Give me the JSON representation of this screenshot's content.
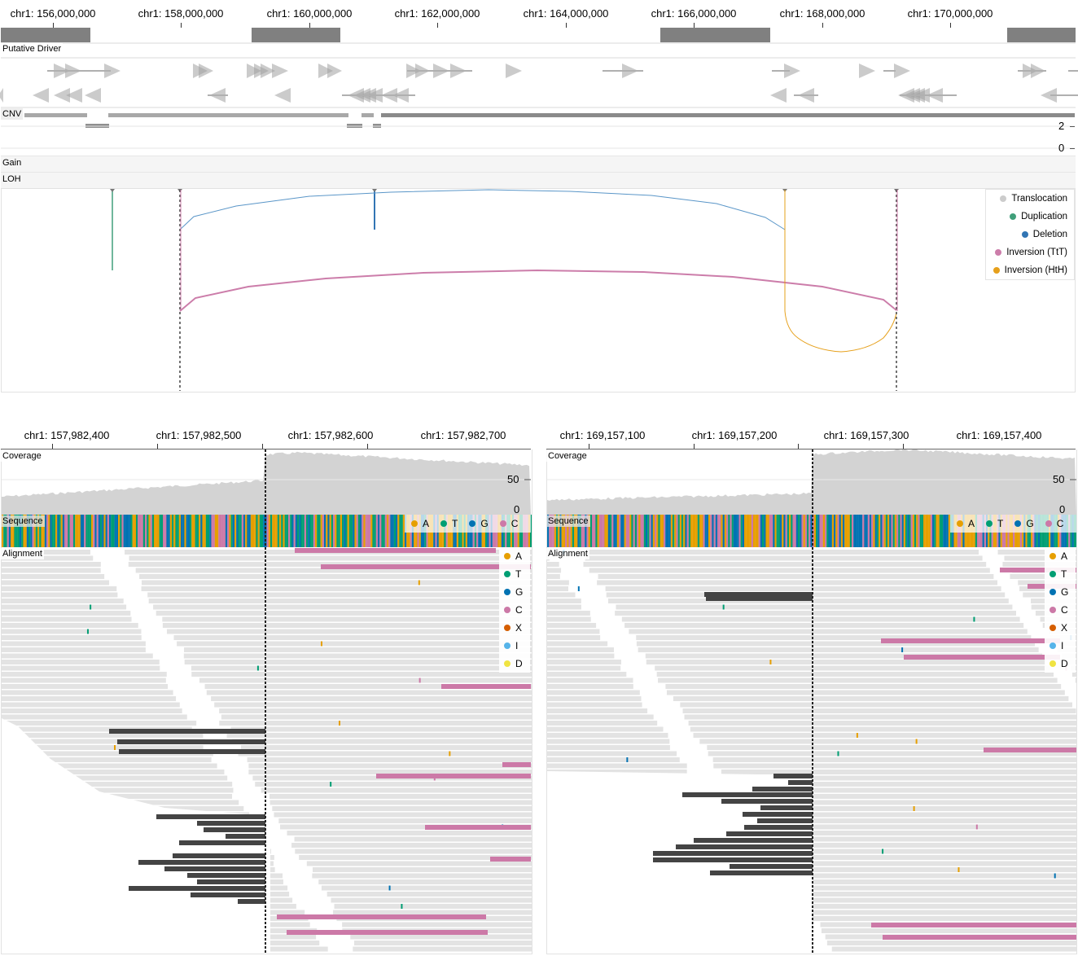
{
  "overview": {
    "axis_ticks": [
      "chr1: 156,000,000",
      "chr1: 158,000,000",
      "chr1: 160,000,000",
      "chr1: 162,000,000",
      "chr1: 164,000,000",
      "chr1: 166,000,000",
      "chr1: 168,000,000",
      "chr1: 170,000,000"
    ],
    "ideogram_dark_bands": [
      [
        0.0,
        0.083
      ],
      [
        0.233,
        0.316
      ],
      [
        0.614,
        0.716
      ],
      [
        0.936,
        1.0
      ]
    ],
    "tracks": {
      "putative_driver": "Putative Driver",
      "cnv": "CNV",
      "gain": "Gain",
      "loh": "LOH"
    },
    "cnv_axis": [
      "2",
      "0"
    ],
    "sv_legend": [
      {
        "label": "Translocation",
        "color": "#cccccc"
      },
      {
        "label": "Duplication",
        "color": "#409F7A"
      },
      {
        "label": "Deletion",
        "color": "#3275B4"
      },
      {
        "label": "Inversion (TtT)",
        "color": "#CC7DAA"
      },
      {
        "label": "Inversion (HtH)",
        "color": "#E6A01B"
      }
    ]
  },
  "left_view": {
    "axis_ticks": [
      "chr1: 157,982,400",
      "chr1: 157,982,500",
      "chr1: 157,982,600",
      "chr1: 157,982,700"
    ],
    "tracks": {
      "coverage": "Coverage",
      "sequence": "Sequence",
      "alignment": "Alignment"
    },
    "coverage_axis": [
      "50",
      "0"
    ]
  },
  "right_view": {
    "axis_ticks": [
      "chr1: 169,157,100",
      "chr1: 169,157,200",
      "chr1: 169,157,300",
      "chr1: 169,157,400"
    ],
    "tracks": {
      "coverage": "Coverage",
      "sequence": "Sequence",
      "alignment": "Alignment"
    },
    "coverage_axis": [
      "50",
      "0"
    ]
  },
  "sequence_legend": [
    {
      "label": "A",
      "color": "#E69F00"
    },
    {
      "label": "T",
      "color": "#009E73"
    },
    {
      "label": "G",
      "color": "#0072B2"
    },
    {
      "label": "C",
      "color": "#CC79A7"
    }
  ],
  "alignment_legend": [
    {
      "label": "A",
      "color": "#E69F00"
    },
    {
      "label": "T",
      "color": "#009E73"
    },
    {
      "label": "G",
      "color": "#0072B2"
    },
    {
      "label": "C",
      "color": "#CC79A7"
    },
    {
      "label": "X",
      "color": "#D55E00"
    },
    {
      "label": "I",
      "color": "#56B4E9"
    },
    {
      "label": "D",
      "color": "#F0E442"
    }
  ]
}
